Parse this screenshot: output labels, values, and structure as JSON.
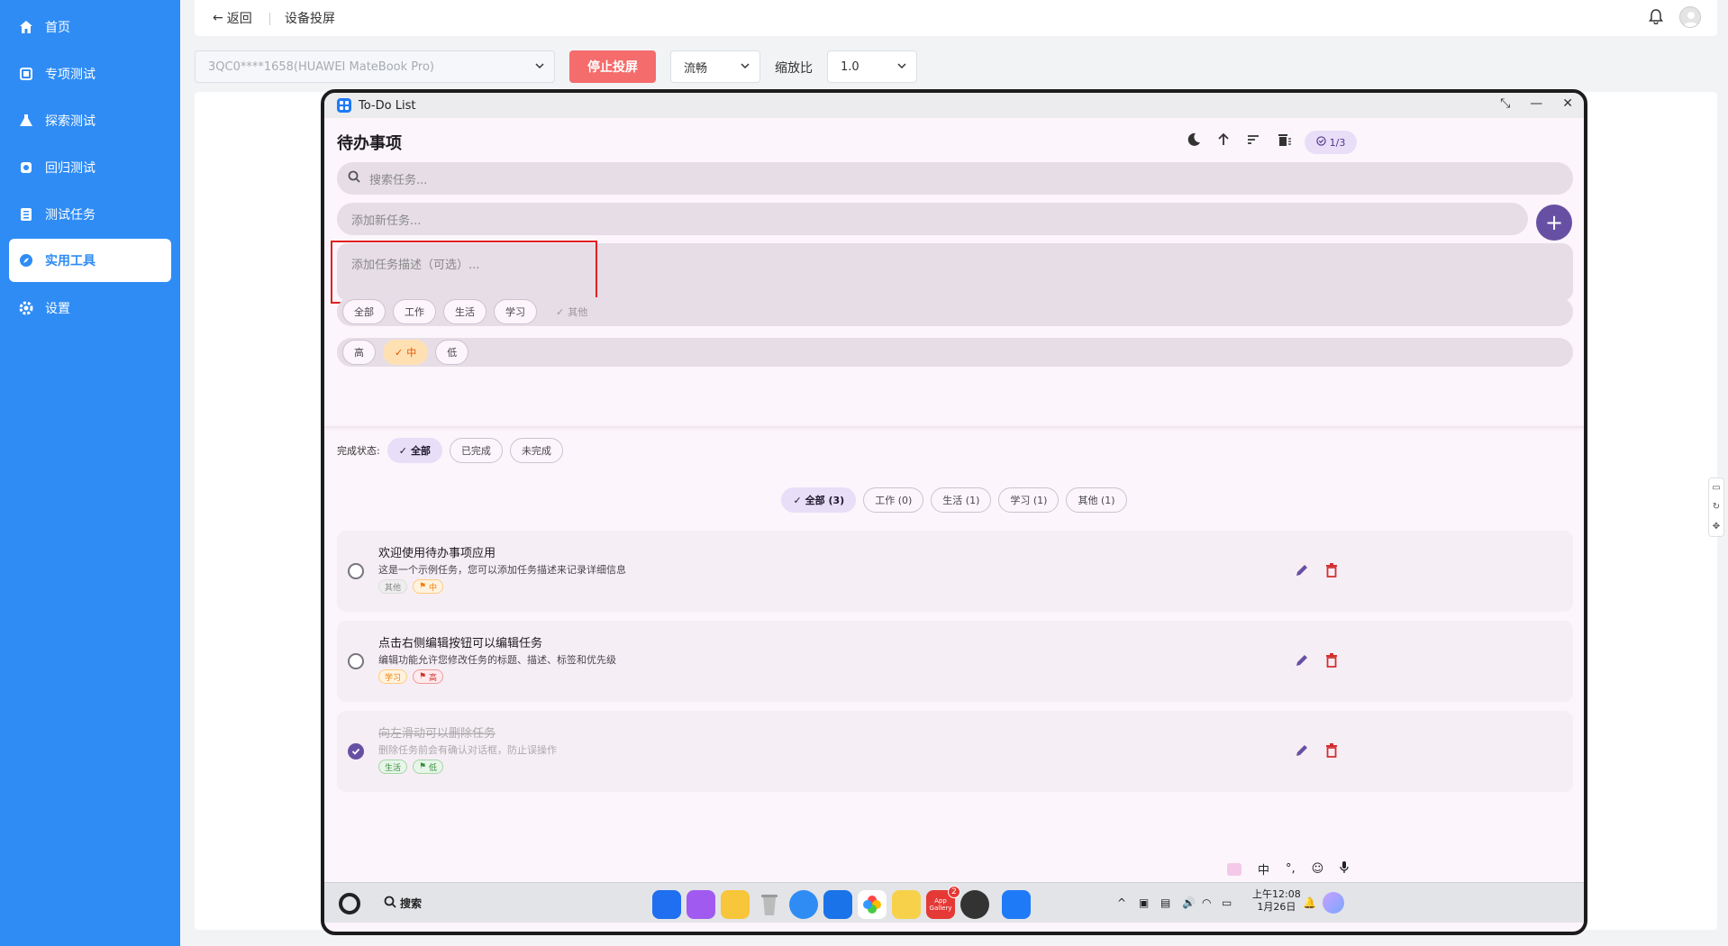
{
  "sidebar": {
    "items": [
      {
        "label": "首页",
        "icon": "home-icon"
      },
      {
        "label": "专项测试",
        "icon": "tablet-icon"
      },
      {
        "label": "探索测试",
        "icon": "flask-icon"
      },
      {
        "label": "回归测试",
        "icon": "refresh-icon"
      },
      {
        "label": "测试任务",
        "icon": "list-icon"
      },
      {
        "label": "实用工具",
        "icon": "compass-icon",
        "active": true
      },
      {
        "label": "设置",
        "icon": "gear-icon"
      }
    ]
  },
  "topbar": {
    "back_label": "返回",
    "breadcrumb": "设备投屏"
  },
  "controls": {
    "device_select": "3QC0****1658(HUAWEI MateBook Pro)",
    "stop_button": "停止投屏",
    "quality_select": "流畅",
    "zoom_label": "缩放比",
    "zoom_select": "1.0"
  },
  "app": {
    "window_title": "To-Do List",
    "title": "待办事项",
    "count_badge": "1/3",
    "search_placeholder": "搜索任务...",
    "add_placeholder": "添加新任务...",
    "desc_placeholder": "添加任务描述（可选）...",
    "category_chips": [
      "全部",
      "工作",
      "生活",
      "学习",
      "其他"
    ],
    "selected_category": "其他",
    "priority_chips": [
      "高",
      "中",
      "低"
    ],
    "selected_priority": "中",
    "status_label": "完成状态:",
    "status_chips": [
      "全部",
      "已完成",
      "未完成"
    ],
    "filter_tabs": [
      "全部 (3)",
      "工作 (0)",
      "生活 (1)",
      "学习 (1)",
      "其他 (1)"
    ],
    "tasks": [
      {
        "title": "欢迎使用待办事项应用",
        "desc": "这是一个示例任务，您可以添加任务描述来记录详细信息",
        "category": "其他",
        "priority": "中",
        "done": false
      },
      {
        "title": "点击右侧编辑按钮可以编辑任务",
        "desc": "编辑功能允许您修改任务的标题、描述、标签和优先级",
        "category": "学习",
        "priority": "高",
        "done": false
      },
      {
        "title": "向左滑动可以删除任务",
        "desc": "删除任务前会有确认对话框，防止误操作",
        "category": "生活",
        "priority": "低",
        "done": true
      }
    ]
  },
  "ime": {
    "lang": "中",
    "punct": "°,"
  },
  "taskbar": {
    "search_label": "搜索",
    "badge_count": "2",
    "appgallery_label": "App Gallery",
    "time": "上午12:08",
    "date": "1月26日"
  },
  "colors": {
    "sidebar": "#2f8cf5",
    "stop": "#f56c6c",
    "primary": "#6750a4"
  }
}
